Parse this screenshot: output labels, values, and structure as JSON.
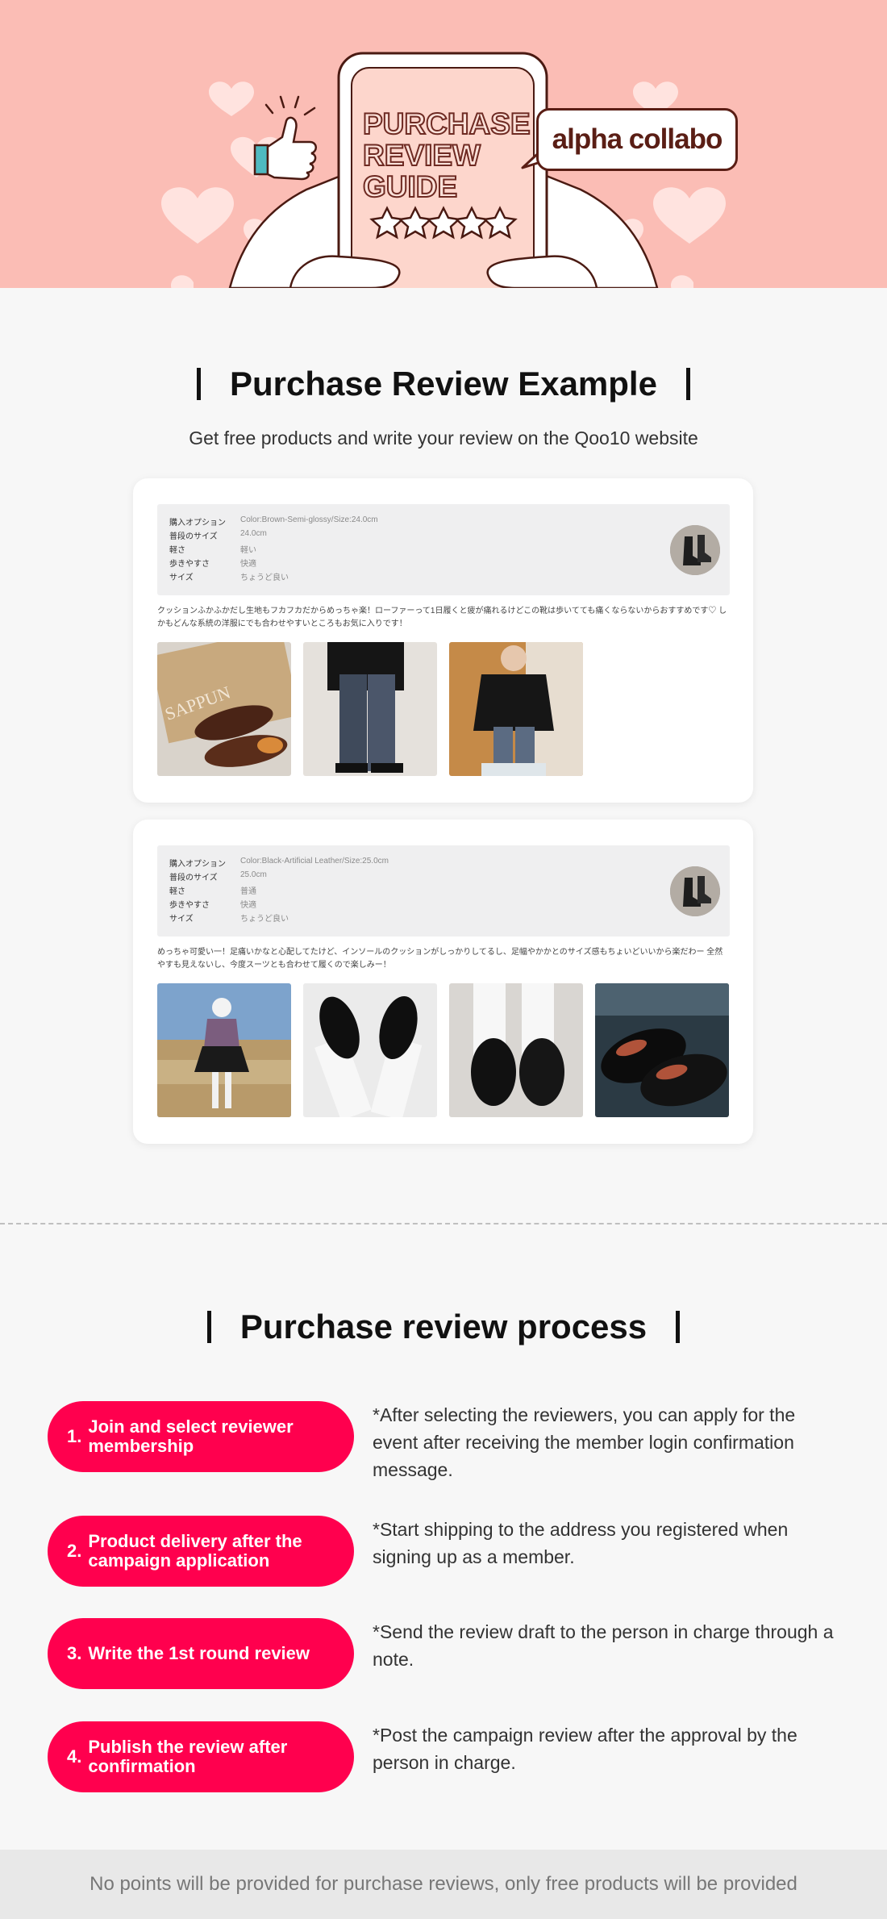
{
  "hero": {
    "title_lines": [
      "PURCHASE",
      "REVIEW",
      "GUIDE"
    ],
    "brand": "alpha collabo",
    "rating_stars": 5,
    "background_color": "#fbbdb5"
  },
  "example": {
    "heading": "Purchase Review Example",
    "subtitle": "Get free products and write your review on the Qoo10 website",
    "reviews": [
      {
        "options": [
          {
            "key": "購入オプション",
            "value": "Color:Brown-Semi-glossy/Size:24.0cm"
          },
          {
            "key": "普段のサイズ",
            "value": "24.0cm"
          },
          {
            "key": "軽さ",
            "value": "軽い"
          },
          {
            "key": "歩きやすさ",
            "value": "快適"
          },
          {
            "key": "サイズ",
            "value": "ちょうど良い"
          }
        ],
        "text": "クッションふかふかだし生地もフカフカだからめっちゃ楽！ローファーって1日履くと疲が痛れるけどこの靴は歩いてても痛くならないからおすすめです♡ しかもどんな系統の洋服にでも合わせやすいところもお気に入りです！",
        "photos": [
          "shoe-box-photo",
          "jeans-outfit-photo",
          "mirror-selfie-photo"
        ]
      },
      {
        "options": [
          {
            "key": "購入オプション",
            "value": "Color:Black-Artificial Leather/Size:25.0cm"
          },
          {
            "key": "普段のサイズ",
            "value": "25.0cm"
          },
          {
            "key": "軽さ",
            "value": "普通"
          },
          {
            "key": "歩きやすさ",
            "value": "快適"
          },
          {
            "key": "サイズ",
            "value": "ちょうど良い"
          }
        ],
        "text": "めっちゃ可愛い一！足痛いかなと心配してたけど、インソールのクッションがしっかりしてるし、足幅やかかとのサイズ感もちょいどいいから楽だわー 全然やすも見えないし、今度スーツとも合わせて履くので楽しみー！",
        "photos": [
          "skirt-outfit-photo",
          "white-socks-loafers-photo",
          "loafers-closeup-photo",
          "loafers-pair-photo"
        ]
      }
    ]
  },
  "process": {
    "heading": "Purchase review process",
    "steps": [
      {
        "num": "1.",
        "label": "Join and select reviewer membership",
        "desc": "*After selecting the reviewers, you can apply for the event after receiving the member login confirmation message."
      },
      {
        "num": "2.",
        "label": "Product delivery after the campaign application",
        "desc": "*Start shipping to the address you registered when signing up as a member."
      },
      {
        "num": "3.",
        "label": "Write the 1st round review",
        "desc": "*Send the review draft to the person in charge through a note."
      },
      {
        "num": "4.",
        "label": "Publish the review after confirmation",
        "desc": "*Post the campaign review after the approval by the person in charge."
      }
    ],
    "accent_color": "#ff004e"
  },
  "footer": {
    "note": "No points will be provided for purchase reviews, only free products will be provided"
  }
}
